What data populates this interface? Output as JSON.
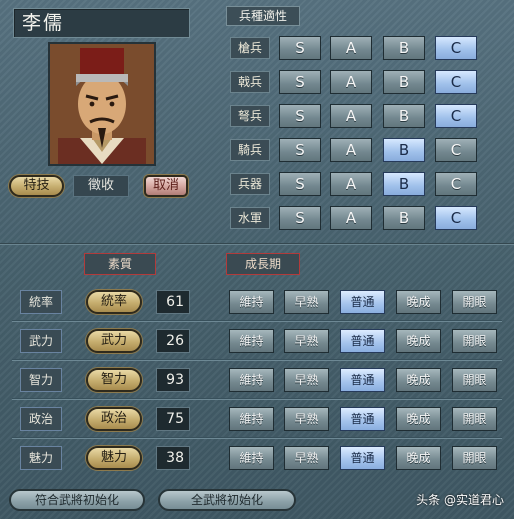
{
  "general": {
    "name": "李儒"
  },
  "skill": {
    "button_label": "特技",
    "value": "徵收",
    "cancel_label": "取消"
  },
  "troop_aptitude": {
    "title": "兵種適性",
    "grades": [
      "S",
      "A",
      "B",
      "C"
    ],
    "rows": [
      {
        "label": "槍兵",
        "selected": "C"
      },
      {
        "label": "戟兵",
        "selected": "C"
      },
      {
        "label": "弩兵",
        "selected": "C"
      },
      {
        "label": "騎兵",
        "selected": "B"
      },
      {
        "label": "兵器",
        "selected": "B"
      },
      {
        "label": "水軍",
        "selected": "C"
      }
    ]
  },
  "stats": {
    "quality_title": "素質",
    "growth_title": "成長期",
    "growth_options": [
      "維持",
      "早熟",
      "普通",
      "晚成",
      "開眼"
    ],
    "rows": [
      {
        "label": "統率",
        "button": "統率",
        "value": "61",
        "growth": "普通"
      },
      {
        "label": "武力",
        "button": "武力",
        "value": "26",
        "growth": "普通"
      },
      {
        "label": "智力",
        "button": "智力",
        "value": "93",
        "growth": "普通"
      },
      {
        "label": "政治",
        "button": "政治",
        "value": "75",
        "growth": "普通"
      },
      {
        "label": "魅力",
        "button": "魅力",
        "value": "38",
        "growth": "普通"
      }
    ]
  },
  "footer": {
    "reset_matching": "符合武將初始化",
    "reset_all": "全武將初始化"
  },
  "watermark": "头条 @实道君心",
  "colors": {
    "selected": "#9fc0ea",
    "unselected": "#72878f",
    "pill": "#c5ad6e",
    "cancel": "#d3a59e",
    "title_border": "#b23b3b"
  }
}
